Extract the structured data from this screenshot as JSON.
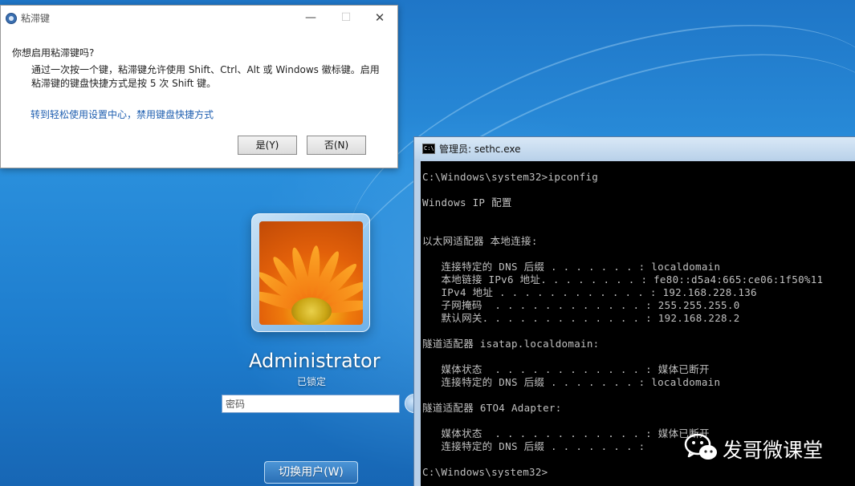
{
  "dialog": {
    "title": "粘滞键",
    "question": "你想启用粘滞键吗?",
    "body_line1": "通过一次按一个键，粘滞键允许使用 Shift、Ctrl、Alt 或 Windows 徽标键。启用",
    "body_line2": "粘滞键的键盘快捷方式是按 5 次 Shift 键。",
    "link": "转到轻松使用设置中心，禁用键盘快捷方式",
    "yes_label": "是(Y)",
    "no_label": "否(N)",
    "minimize_glyph": "—",
    "maximize_glyph": "☐",
    "close_glyph": "✕",
    "app_icon": "ease-of-access-icon"
  },
  "logon": {
    "user_name": "Administrator",
    "status": "已锁定",
    "password_placeholder": "密码",
    "switch_user_label": "切换用户(W)",
    "go_icon": "arrow-right-icon"
  },
  "console": {
    "title": "管理员: sethc.exe",
    "icon_text": "C:\\",
    "lines": [
      "C:\\Windows\\system32>ipconfig",
      "",
      "Windows IP 配置",
      "",
      "",
      "以太网适配器 本地连接:",
      "",
      "   连接特定的 DNS 后缀 . . . . . . . : localdomain",
      "   本地链接 IPv6 地址. . . . . . . . : fe80::d5a4:665:ce06:1f50%11",
      "   IPv4 地址 . . . . . . . . . . . . : 192.168.228.136",
      "   子网掩码  . . . . . . . . . . . . : 255.255.255.0",
      "   默认网关. . . . . . . . . . . . . : 192.168.228.2",
      "",
      "隧道适配器 isatap.localdomain:",
      "",
      "   媒体状态  . . . . . . . . . . . . : 媒体已断开",
      "   连接特定的 DNS 后缀 . . . . . . . : localdomain",
      "",
      "隧道适配器 6TO4 Adapter:",
      "",
      "   媒体状态  . . . . . . . . . . . . : 媒体已断开",
      "   连接特定的 DNS 后缀 . . . . . . . :",
      "",
      "C:\\Windows\\system32>"
    ]
  },
  "watermark": {
    "text": "发哥微课堂",
    "icon": "wechat-icon"
  }
}
